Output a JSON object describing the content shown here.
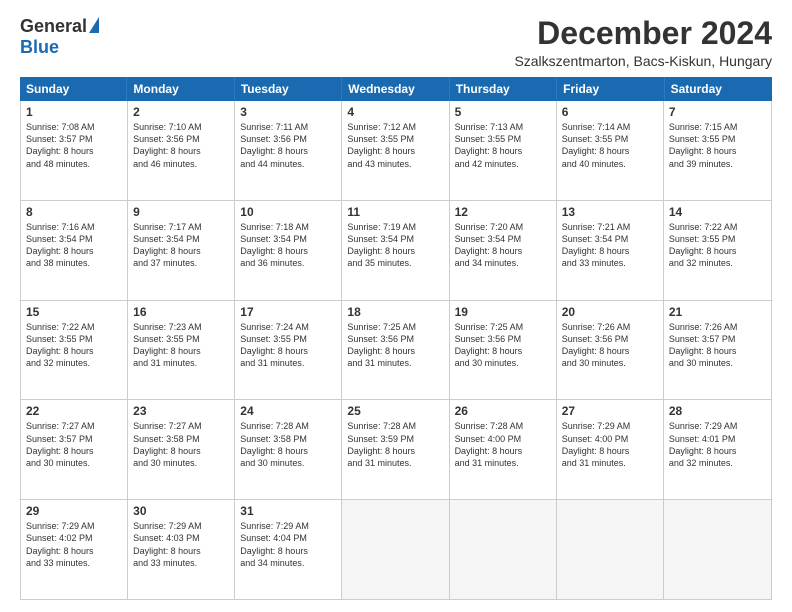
{
  "logo": {
    "general": "General",
    "blue": "Blue"
  },
  "title": "December 2024",
  "location": "Szalkszentmarton, Bacs-Kiskun, Hungary",
  "header_days": [
    "Sunday",
    "Monday",
    "Tuesday",
    "Wednesday",
    "Thursday",
    "Friday",
    "Saturday"
  ],
  "weeks": [
    [
      {
        "day": "1",
        "lines": [
          "Sunrise: 7:08 AM",
          "Sunset: 3:57 PM",
          "Daylight: 8 hours",
          "and 48 minutes."
        ]
      },
      {
        "day": "2",
        "lines": [
          "Sunrise: 7:10 AM",
          "Sunset: 3:56 PM",
          "Daylight: 8 hours",
          "and 46 minutes."
        ]
      },
      {
        "day": "3",
        "lines": [
          "Sunrise: 7:11 AM",
          "Sunset: 3:56 PM",
          "Daylight: 8 hours",
          "and 44 minutes."
        ]
      },
      {
        "day": "4",
        "lines": [
          "Sunrise: 7:12 AM",
          "Sunset: 3:55 PM",
          "Daylight: 8 hours",
          "and 43 minutes."
        ]
      },
      {
        "day": "5",
        "lines": [
          "Sunrise: 7:13 AM",
          "Sunset: 3:55 PM",
          "Daylight: 8 hours",
          "and 42 minutes."
        ]
      },
      {
        "day": "6",
        "lines": [
          "Sunrise: 7:14 AM",
          "Sunset: 3:55 PM",
          "Daylight: 8 hours",
          "and 40 minutes."
        ]
      },
      {
        "day": "7",
        "lines": [
          "Sunrise: 7:15 AM",
          "Sunset: 3:55 PM",
          "Daylight: 8 hours",
          "and 39 minutes."
        ]
      }
    ],
    [
      {
        "day": "8",
        "lines": [
          "Sunrise: 7:16 AM",
          "Sunset: 3:54 PM",
          "Daylight: 8 hours",
          "and 38 minutes."
        ]
      },
      {
        "day": "9",
        "lines": [
          "Sunrise: 7:17 AM",
          "Sunset: 3:54 PM",
          "Daylight: 8 hours",
          "and 37 minutes."
        ]
      },
      {
        "day": "10",
        "lines": [
          "Sunrise: 7:18 AM",
          "Sunset: 3:54 PM",
          "Daylight: 8 hours",
          "and 36 minutes."
        ]
      },
      {
        "day": "11",
        "lines": [
          "Sunrise: 7:19 AM",
          "Sunset: 3:54 PM",
          "Daylight: 8 hours",
          "and 35 minutes."
        ]
      },
      {
        "day": "12",
        "lines": [
          "Sunrise: 7:20 AM",
          "Sunset: 3:54 PM",
          "Daylight: 8 hours",
          "and 34 minutes."
        ]
      },
      {
        "day": "13",
        "lines": [
          "Sunrise: 7:21 AM",
          "Sunset: 3:54 PM",
          "Daylight: 8 hours",
          "and 33 minutes."
        ]
      },
      {
        "day": "14",
        "lines": [
          "Sunrise: 7:22 AM",
          "Sunset: 3:55 PM",
          "Daylight: 8 hours",
          "and 32 minutes."
        ]
      }
    ],
    [
      {
        "day": "15",
        "lines": [
          "Sunrise: 7:22 AM",
          "Sunset: 3:55 PM",
          "Daylight: 8 hours",
          "and 32 minutes."
        ]
      },
      {
        "day": "16",
        "lines": [
          "Sunrise: 7:23 AM",
          "Sunset: 3:55 PM",
          "Daylight: 8 hours",
          "and 31 minutes."
        ]
      },
      {
        "day": "17",
        "lines": [
          "Sunrise: 7:24 AM",
          "Sunset: 3:55 PM",
          "Daylight: 8 hours",
          "and 31 minutes."
        ]
      },
      {
        "day": "18",
        "lines": [
          "Sunrise: 7:25 AM",
          "Sunset: 3:56 PM",
          "Daylight: 8 hours",
          "and 31 minutes."
        ]
      },
      {
        "day": "19",
        "lines": [
          "Sunrise: 7:25 AM",
          "Sunset: 3:56 PM",
          "Daylight: 8 hours",
          "and 30 minutes."
        ]
      },
      {
        "day": "20",
        "lines": [
          "Sunrise: 7:26 AM",
          "Sunset: 3:56 PM",
          "Daylight: 8 hours",
          "and 30 minutes."
        ]
      },
      {
        "day": "21",
        "lines": [
          "Sunrise: 7:26 AM",
          "Sunset: 3:57 PM",
          "Daylight: 8 hours",
          "and 30 minutes."
        ]
      }
    ],
    [
      {
        "day": "22",
        "lines": [
          "Sunrise: 7:27 AM",
          "Sunset: 3:57 PM",
          "Daylight: 8 hours",
          "and 30 minutes."
        ]
      },
      {
        "day": "23",
        "lines": [
          "Sunrise: 7:27 AM",
          "Sunset: 3:58 PM",
          "Daylight: 8 hours",
          "and 30 minutes."
        ]
      },
      {
        "day": "24",
        "lines": [
          "Sunrise: 7:28 AM",
          "Sunset: 3:58 PM",
          "Daylight: 8 hours",
          "and 30 minutes."
        ]
      },
      {
        "day": "25",
        "lines": [
          "Sunrise: 7:28 AM",
          "Sunset: 3:59 PM",
          "Daylight: 8 hours",
          "and 31 minutes."
        ]
      },
      {
        "day": "26",
        "lines": [
          "Sunrise: 7:28 AM",
          "Sunset: 4:00 PM",
          "Daylight: 8 hours",
          "and 31 minutes."
        ]
      },
      {
        "day": "27",
        "lines": [
          "Sunrise: 7:29 AM",
          "Sunset: 4:00 PM",
          "Daylight: 8 hours",
          "and 31 minutes."
        ]
      },
      {
        "day": "28",
        "lines": [
          "Sunrise: 7:29 AM",
          "Sunset: 4:01 PM",
          "Daylight: 8 hours",
          "and 32 minutes."
        ]
      }
    ],
    [
      {
        "day": "29",
        "lines": [
          "Sunrise: 7:29 AM",
          "Sunset: 4:02 PM",
          "Daylight: 8 hours",
          "and 33 minutes."
        ]
      },
      {
        "day": "30",
        "lines": [
          "Sunrise: 7:29 AM",
          "Sunset: 4:03 PM",
          "Daylight: 8 hours",
          "and 33 minutes."
        ]
      },
      {
        "day": "31",
        "lines": [
          "Sunrise: 7:29 AM",
          "Sunset: 4:04 PM",
          "Daylight: 8 hours",
          "and 34 minutes."
        ]
      },
      {
        "day": "",
        "lines": []
      },
      {
        "day": "",
        "lines": []
      },
      {
        "day": "",
        "lines": []
      },
      {
        "day": "",
        "lines": []
      }
    ]
  ]
}
